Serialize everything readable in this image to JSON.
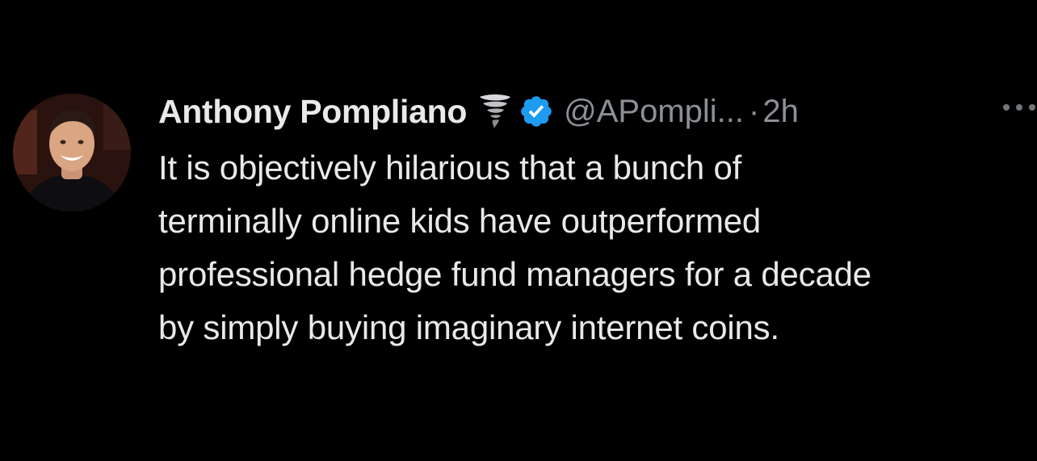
{
  "tweet": {
    "author": {
      "display_name": "Anthony Pompliano",
      "name_emoji": "tornado-icon",
      "verified_badge": "verified-badge-icon",
      "handle": "@APompli...",
      "separator": "·",
      "timestamp": "2h"
    },
    "text": "It is objectively hilarious that a bunch of\nterminally online kids have outperformed\nprofessional hedge fund managers for a decade\nby simply buying imaginary internet coins.",
    "more_menu_icon": "more-options-icon"
  },
  "colors": {
    "background": "#000000",
    "text_primary": "#e7e9ea",
    "text_secondary": "#8b9096",
    "verified_blue": "#1d9bf0"
  }
}
